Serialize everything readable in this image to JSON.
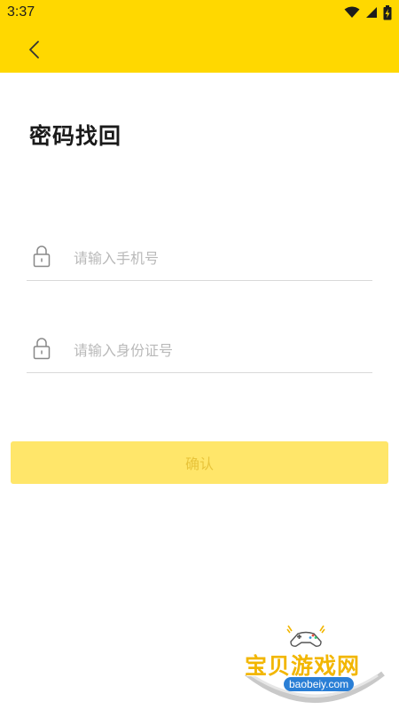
{
  "status_bar": {
    "time": "3:37",
    "icons": [
      "wifi-icon",
      "signal-icon",
      "battery-icon"
    ]
  },
  "app_bar": {
    "back_icon": "chevron-left-icon",
    "background_color": "#FFD800"
  },
  "page": {
    "title": "密码找回"
  },
  "form": {
    "phone": {
      "placeholder": "请输入手机号",
      "value": "",
      "icon": "lock-icon"
    },
    "id_card": {
      "placeholder": "请输入身份证号",
      "value": "",
      "icon": "lock-icon"
    },
    "confirm_label": "确认",
    "confirm_color": "#FFE66A"
  },
  "watermark": {
    "brand": "宝贝游戏网",
    "domain": "baobeiy.com",
    "icon": "gamepad-icon"
  }
}
